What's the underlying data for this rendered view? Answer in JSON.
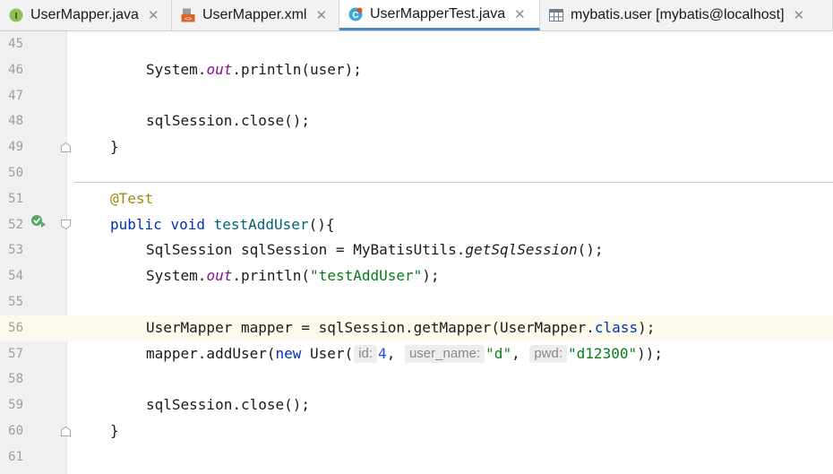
{
  "tabs": [
    {
      "label": "UserMapper.java",
      "icon": "interface-icon",
      "active": false
    },
    {
      "label": "UserMapper.xml",
      "icon": "xml-file-icon",
      "active": false
    },
    {
      "label": "UserMapperTest.java",
      "icon": "test-class-icon",
      "active": true
    },
    {
      "label": "mybatis.user [mybatis@localhost]",
      "icon": "table-icon",
      "active": false
    }
  ],
  "editor": {
    "highlighted_line": "56",
    "lines": [
      {
        "num": "45"
      },
      {
        "num": "46",
        "t1": "System.",
        "t2": "out",
        "t3": ".println(user);"
      },
      {
        "num": "47"
      },
      {
        "num": "48",
        "t1": "sqlSession.close();"
      },
      {
        "num": "49",
        "t1": "}"
      },
      {
        "num": "50"
      },
      {
        "num": "51",
        "t1": "@Test"
      },
      {
        "num": "52",
        "t1": "public",
        "t2": "void",
        "t3": "testAddUser",
        "t4": "(){"
      },
      {
        "num": "53",
        "t1": "SqlSession sqlSession = MyBatisUtils.",
        "t2": "getSqlSession",
        "t3": "();"
      },
      {
        "num": "54",
        "t1": "System.",
        "t2": "out",
        "t3": ".println(",
        "t4": "\"testAddUser\"",
        "t5": ");"
      },
      {
        "num": "55"
      },
      {
        "num": "56",
        "t1": "UserMapper mapper = sqlSession.getMapper(UserMapper.",
        "t2": "class",
        "t3": ");"
      },
      {
        "num": "57",
        "t1": "mapper.addUser(",
        "t2": "new",
        "t3": " User(",
        "h1": "id:",
        "t4": "4",
        "t5": ", ",
        "h2": "user_name:",
        "t6": "\"d\"",
        "t7": ", ",
        "h3": "pwd:",
        "t8": "\"d12300\"",
        "t9": "));"
      },
      {
        "num": "58"
      },
      {
        "num": "59",
        "t1": "sqlSession.close();"
      },
      {
        "num": "60",
        "t1": "}"
      },
      {
        "num": "61"
      }
    ]
  },
  "colors": {
    "keyword": "#0033b3",
    "string": "#067d17",
    "annotation": "#9e880d",
    "field": "#871094",
    "number": "#1750eb",
    "method_decl": "#00627a",
    "active_tab_underline": "#4a88c7"
  }
}
